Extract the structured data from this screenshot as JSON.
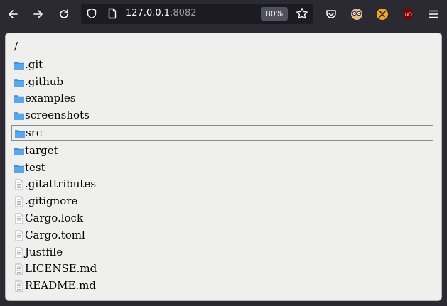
{
  "browser": {
    "url_host": "127.0.0.1",
    "url_port": ":8082",
    "zoom": "80%",
    "icons": {
      "back": "back-arrow-icon",
      "forward": "forward-arrow-icon",
      "reload": "reload-icon",
      "shield": "tracking-protection-shield-icon",
      "page": "page-info-icon",
      "bookmark": "bookmark-star-icon",
      "pocket": "pocket-icon",
      "ext1": "glasses-extension-icon",
      "ext2": "orange-extension-icon",
      "ext3": "ublock-origin-icon",
      "menu": "hamburger-menu-icon"
    }
  },
  "listing": {
    "path": "/",
    "entries": [
      {
        "name": ".git",
        "type": "folder"
      },
      {
        "name": ".github",
        "type": "folder"
      },
      {
        "name": "examples",
        "type": "folder"
      },
      {
        "name": "screenshots",
        "type": "folder"
      },
      {
        "name": "src",
        "type": "folder",
        "selected": true
      },
      {
        "name": "target",
        "type": "folder"
      },
      {
        "name": "test",
        "type": "folder"
      },
      {
        "name": ".gitattributes",
        "type": "file"
      },
      {
        "name": ".gitignore",
        "type": "file"
      },
      {
        "name": "Cargo.lock",
        "type": "file"
      },
      {
        "name": "Cargo.toml",
        "type": "file"
      },
      {
        "name": "Justfile",
        "type": "file"
      },
      {
        "name": "LICENSE.md",
        "type": "file"
      },
      {
        "name": "README.md",
        "type": "file"
      }
    ]
  },
  "colors": {
    "folder": "#3f8fd4",
    "file": "#a9b0b6",
    "page_bg": "#eff0ed",
    "chrome_bg": "#2b2a33"
  }
}
